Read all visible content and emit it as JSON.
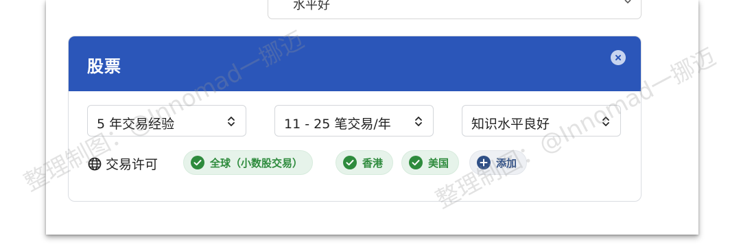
{
  "top_select": {
    "value": "水平好"
  },
  "card": {
    "title": "股票",
    "selects": {
      "experience": "5 年交易经验",
      "frequency": "11 - 25 笔交易/年",
      "knowledge": "知识水平良好"
    },
    "permit_label": "交易许可",
    "permits": [
      "全球（小数股交易）",
      "香港",
      "美国"
    ],
    "add_label": "添加"
  },
  "watermark": "整理制图：@Innomad一挪迈",
  "colors": {
    "header": "#2b56b9",
    "chip_green": "#2e8b3d",
    "chip_bg": "#e6f3ea"
  }
}
